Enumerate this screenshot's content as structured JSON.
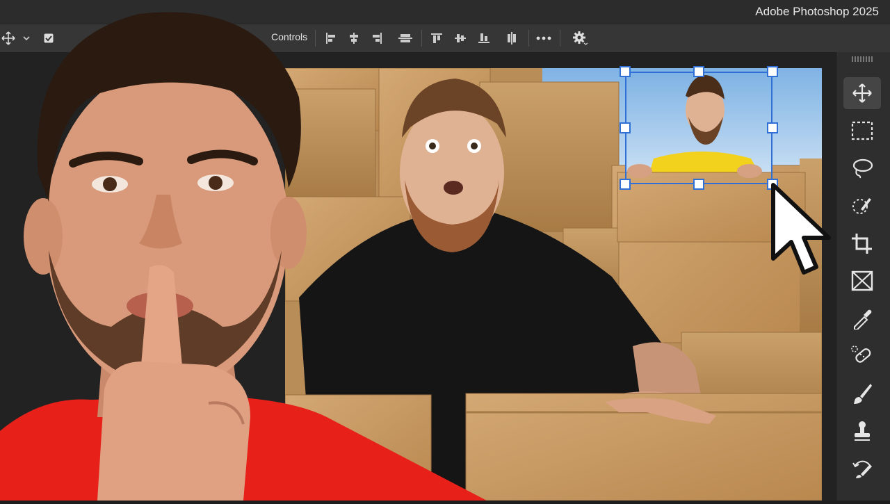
{
  "app": {
    "title": "Adobe Photoshop 2025"
  },
  "options_bar": {
    "controls_label": "Controls",
    "icons": [
      "move-icon",
      "chevron-down-icon",
      "checkbox-icon",
      "align-left-icon",
      "align-center-h-icon",
      "align-right-icon",
      "distribute-h-icon",
      "align-top-icon",
      "align-middle-v-icon",
      "align-bottom-icon",
      "distribute-v-icon",
      "more-icon",
      "gear-icon"
    ]
  },
  "toolbar": {
    "tools": [
      "move-tool",
      "rectangular-marquee-tool",
      "lasso-tool",
      "quick-selection-tool",
      "crop-tool",
      "frame-tool",
      "eyedropper-tool",
      "spot-healing-brush-tool",
      "brush-tool",
      "clone-stamp-tool",
      "history-brush-tool"
    ],
    "active_tool": "move-tool"
  },
  "colors": {
    "accent": "#2f6fd6",
    "panel": "#2e2e2e",
    "shirt_red": "#e8201a",
    "cardboard": "#c79a63"
  }
}
